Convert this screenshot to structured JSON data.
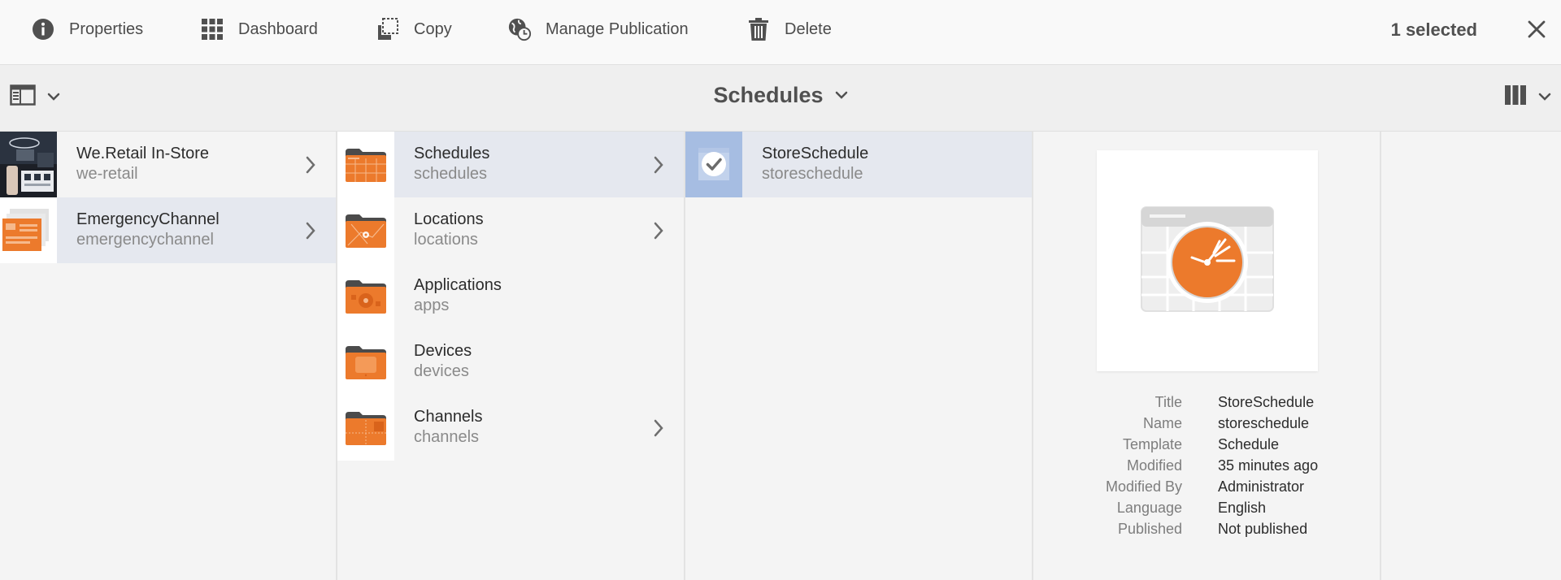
{
  "actionbar": {
    "properties": "Properties",
    "dashboard": "Dashboard",
    "copy": "Copy",
    "manage_publication": "Manage Publication",
    "delete": "Delete",
    "selected_count": "1 selected"
  },
  "titlebar": {
    "title": "Schedules"
  },
  "columns": {
    "projects": [
      {
        "title": "We.Retail In-Store",
        "name": "we-retail"
      },
      {
        "title": "EmergencyChannel",
        "name": "emergencychannel"
      }
    ],
    "folders": [
      {
        "title": "Schedules",
        "name": "schedules"
      },
      {
        "title": "Locations",
        "name": "locations"
      },
      {
        "title": "Applications",
        "name": "apps"
      },
      {
        "title": "Devices",
        "name": "devices"
      },
      {
        "title": "Channels",
        "name": "channels"
      }
    ],
    "schedules": [
      {
        "title": "StoreSchedule",
        "name": "storeschedule"
      }
    ]
  },
  "preview": {
    "meta": [
      {
        "key": "Title",
        "value": "StoreSchedule"
      },
      {
        "key": "Name",
        "value": "storeschedule"
      },
      {
        "key": "Template",
        "value": "Schedule"
      },
      {
        "key": "Modified",
        "value": "35 minutes ago"
      },
      {
        "key": "Modified By",
        "value": "Administrator"
      },
      {
        "key": "Language",
        "value": "English"
      },
      {
        "key": "Published",
        "value": "Not published"
      }
    ]
  },
  "colors": {
    "accent_orange": "#ec7a2c",
    "selected_row": "#e5e8ef",
    "checked_thumb": "#a6bde2"
  }
}
